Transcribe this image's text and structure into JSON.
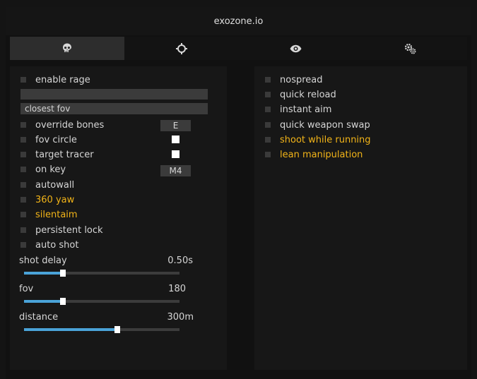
{
  "window": {
    "title": "exozone.io"
  },
  "tabs": [
    {
      "icon": "skull-icon",
      "active": true
    },
    {
      "icon": "crosshair-icon",
      "active": false
    },
    {
      "icon": "eye-icon",
      "active": false
    },
    {
      "icon": "gears-icon",
      "active": false
    }
  ],
  "left": {
    "enable_rage": "enable rage",
    "target_mode": "closest fov",
    "override_bones": "override bones",
    "override_bones_key": "E",
    "fov_circle": "fov circle",
    "target_tracer": "target tracer",
    "on_key": "on key",
    "on_key_key": "M4",
    "autowall": "autowall",
    "yaw360": "360 yaw",
    "silentaim": "silentaim",
    "persistent_lock": "persistent lock",
    "auto_shot": "auto shot",
    "sliders": {
      "shot_delay": {
        "label": "shot delay",
        "value": "0.50s",
        "fraction": 0.25
      },
      "fov": {
        "label": "fov",
        "value": "180",
        "fraction": 0.25
      },
      "distance": {
        "label": "distance",
        "value": "300m",
        "fraction": 0.6
      }
    }
  },
  "right": {
    "nospread": "nospread",
    "quick_reload": "quick reload",
    "instant_aim": "instant aim",
    "quick_weapon_swap": "quick weapon swap",
    "shoot_while_running": "shoot while running",
    "lean_manipulation": "lean manipulation"
  },
  "colors": {
    "accent": "#4aa3d8",
    "warning_label": "#f2b418",
    "swatch": "#ffffff"
  }
}
